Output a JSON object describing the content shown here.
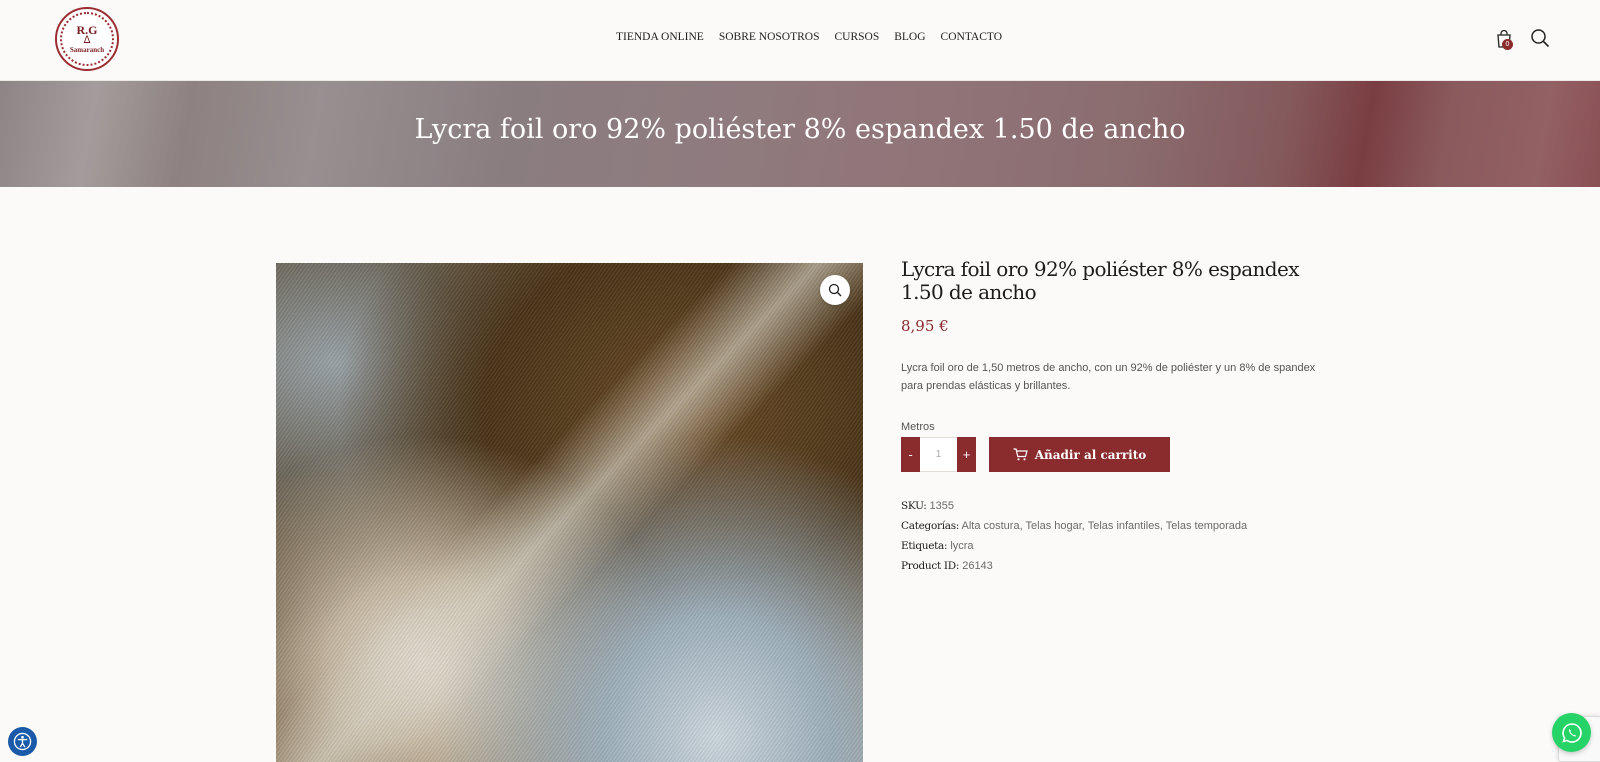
{
  "header": {
    "logo": {
      "line1": "R.G",
      "line2": "Samaranch"
    },
    "nav": [
      {
        "label": "TIENDA ONLINE"
      },
      {
        "label": "SOBRE NOSOTROS"
      },
      {
        "label": "CURSOS"
      },
      {
        "label": "BLOG"
      },
      {
        "label": "CONTACTO"
      }
    ],
    "cart_count": "0",
    "icons": {
      "cart": "shopping-bag-icon",
      "search": "search-icon"
    }
  },
  "banner": {
    "title": "Lycra foil oro 92% poliéster 8% espandex 1.50 de ancho"
  },
  "product": {
    "title": "Lycra foil oro 92% poliéster 8% espandex 1.50 de ancho",
    "price": "8,95 €",
    "description": "Lycra foil oro de 1,50 metros de ancho, con un 92% de poliéster y un 8% de spandex para prendas elásticas y brillantes.",
    "quantity_label": "Metros",
    "quantity_value": "1",
    "minus": "-",
    "plus": "+",
    "add_to_cart": "Añadir al carrito",
    "sku_label": "SKU:",
    "sku": "1355",
    "categories_label": "Categorías:",
    "categories": [
      "Alta costura",
      "Telas hogar",
      "Telas infantiles",
      "Telas temporada"
    ],
    "tag_label": "Etiqueta:",
    "tag": "lycra",
    "product_id_label": "Product ID:",
    "product_id": "26143"
  },
  "colors": {
    "accent": "#8a2b2e",
    "whatsapp": "#25d366",
    "accessibility": "#1a5aa8"
  }
}
